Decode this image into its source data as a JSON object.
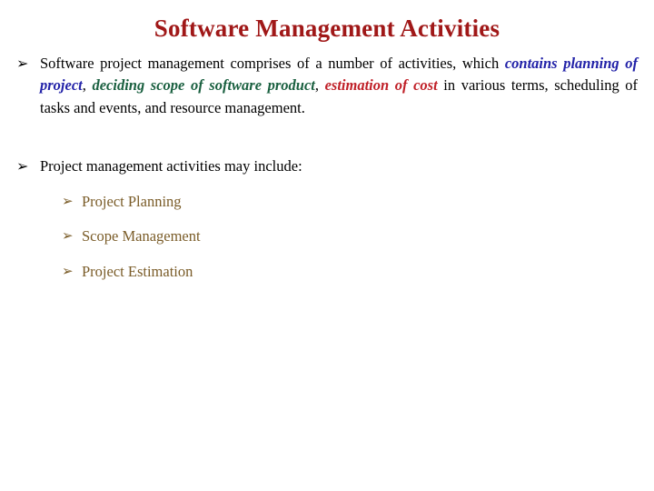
{
  "slide": {
    "title": "Software Management Activities",
    "title_color": "#A01818",
    "background_color": "#FFFFFF"
  },
  "colors": {
    "blue": "#2222A8",
    "green": "#1A6040",
    "red": "#C02028",
    "brown": "#7A5C28",
    "black": "#000000",
    "title_red": "#A01818"
  },
  "bullets": {
    "glyph": "➢",
    "level1": [
      {
        "id": "activities-paragraph",
        "runs": [
          {
            "text": "Software project management comprises of a number of activities, which ",
            "style": "black"
          },
          {
            "text": "contains planning of project",
            "style": "blue"
          },
          {
            "text": ", ",
            "style": "black"
          },
          {
            "text": "deciding scope of software product",
            "style": "green"
          },
          {
            "text": ", ",
            "style": "black"
          },
          {
            "text": "estimation of cost",
            "style": "red"
          },
          {
            "text": " in various terms, scheduling of tasks and events, and resource management.",
            "style": "black"
          }
        ]
      },
      {
        "id": "activities-intro",
        "text": "Project management activities may include:"
      }
    ],
    "level2": [
      {
        "label": "Project Planning"
      },
      {
        "label": "Scope Management"
      },
      {
        "label": "Project Estimation"
      }
    ]
  }
}
